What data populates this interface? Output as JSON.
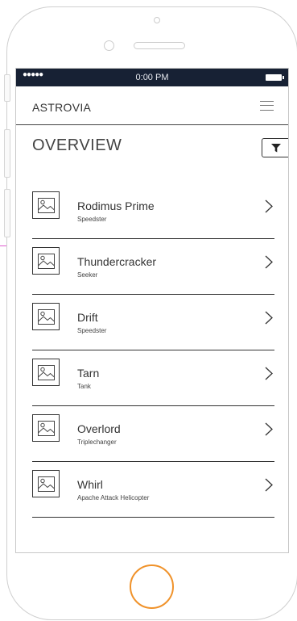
{
  "status_bar": {
    "signal": "●●●●●",
    "time": "0:00 PM"
  },
  "header": {
    "brand": "ASTROVIA"
  },
  "page": {
    "title": "OVERVIEW"
  },
  "items": [
    {
      "name": "Rodimus Prime",
      "subtitle": "Speedster"
    },
    {
      "name": "Thundercracker",
      "subtitle": "Seeker"
    },
    {
      "name": "Drift",
      "subtitle": "Speedster"
    },
    {
      "name": "Tarn",
      "subtitle": "Tank"
    },
    {
      "name": "Overlord",
      "subtitle": "Triplechanger"
    },
    {
      "name": "Whirl",
      "subtitle": "Apache Attack Helicopter"
    }
  ],
  "icons": {
    "menu": "hamburger-icon",
    "filter": "filter-icon",
    "thumbnail": "image-placeholder-icon",
    "chevron": "chevron-right-icon"
  },
  "colors": {
    "status_bar": "#172134",
    "home_button": "#f0922a",
    "accent_line": "#e05bd0"
  }
}
